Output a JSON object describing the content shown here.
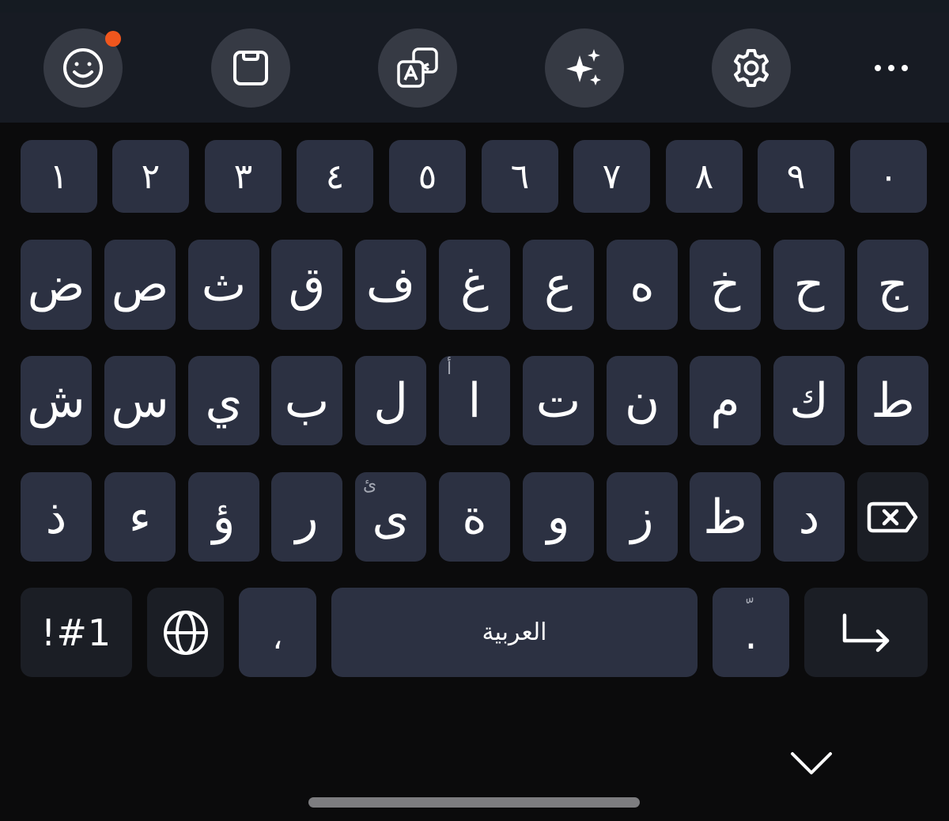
{
  "toolbar": {
    "buttons": [
      {
        "icon": "emoji-icon"
      },
      {
        "icon": "clipboard-icon"
      },
      {
        "icon": "translate-icon"
      },
      {
        "icon": "sparkle-icon"
      },
      {
        "icon": "settings-icon"
      }
    ],
    "more_icon": "more-icon",
    "notification_color": "#f0561d"
  },
  "keyboard": {
    "number_row": [
      "١",
      "٢",
      "٣",
      "٤",
      "٥",
      "٦",
      "٧",
      "٨",
      "٩",
      "٠"
    ],
    "row2": [
      "ض",
      "ص",
      "ث",
      "ق",
      "ف",
      "غ",
      "ع",
      "ه",
      "خ",
      "ح",
      "ج"
    ],
    "row3": [
      "ش",
      "س",
      "ي",
      "ب",
      "ل",
      "ا",
      "ت",
      "ن",
      "م",
      "ك",
      "ط"
    ],
    "row3_hints": {
      "ا": "أ"
    },
    "row4": [
      "ذ",
      "ء",
      "ؤ",
      "ر",
      "ى",
      "ة",
      "و",
      "ز",
      "ظ",
      "د"
    ],
    "row4_hints": {
      "ى": "ئ"
    },
    "backspace_icon": "backspace-icon",
    "bottom_row": {
      "symbols_label": "!#1",
      "language_icon": "globe-icon",
      "comma_label": "،",
      "space_label": "العربية",
      "period_label": ".",
      "period_hint": "ّ",
      "enter_icon": "enter-icon"
    },
    "collapse_icon": "chevron-down-icon"
  },
  "colors": {
    "key_background": "#2c3142",
    "function_key_background": "#1b1e25",
    "toolbar_background": "#171b23",
    "keyboard_background": "#0b0b0c"
  }
}
